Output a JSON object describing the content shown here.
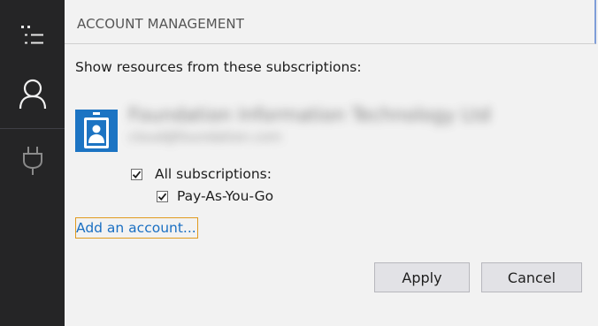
{
  "sidebar": {
    "items": [
      {
        "icon": "list-icon"
      },
      {
        "icon": "user-icon"
      },
      {
        "icon": "plug-icon"
      }
    ]
  },
  "header": {
    "title": "ACCOUNT MANAGEMENT"
  },
  "main": {
    "prompt": "Show resources from these subscriptions:",
    "account": {
      "name_blurred": "Foundation Information Technology Ltd",
      "email_blurred": "cloud@foundation.com"
    },
    "subscriptions": {
      "all_label": "All subscriptions:",
      "all_checked": true,
      "items": [
        {
          "label": "Pay-As-You-Go",
          "checked": true
        }
      ]
    },
    "add_account_label": "Add an account..."
  },
  "footer": {
    "apply_label": "Apply",
    "cancel_label": "Cancel"
  },
  "colors": {
    "sidebar_bg": "#252526",
    "panel_bg": "#f2f2f2",
    "link": "#1a6fc2",
    "focus_ring": "#e09a1e",
    "avatar_bg": "#1c74c3"
  }
}
